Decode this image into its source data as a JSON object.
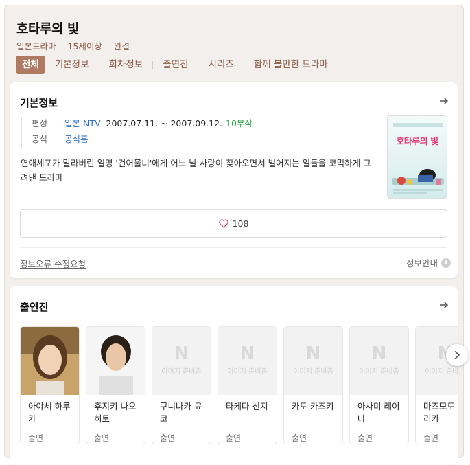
{
  "header": {
    "title": "호타루의 빛",
    "meta": [
      "일본드라마",
      "15세이상",
      "완결"
    ]
  },
  "tabs": [
    "전체",
    "기본정보",
    "회차정보",
    "출연진",
    "시리즈",
    "함께 볼만한 드라마"
  ],
  "basic_info": {
    "section_title": "기본정보",
    "broadcast_label": "편성",
    "broadcaster": "일본 NTV",
    "period": "2007.07.11. ~ 2007.09.12.",
    "episodes": "10부작",
    "official_label": "공식",
    "official_link": "공식홈",
    "description": "연애세포가 말라버린 일명 '건어물녀'에게 어느 날 사랑이 찾아오면서 벌어지는 일들을 코믹하게 그려낸 드라마",
    "poster_title": "호타루의 빛",
    "like_count": "108",
    "report_link": "정보오류 수정요청",
    "info_guide": "정보안내"
  },
  "cast": {
    "section_title": "출연진",
    "placeholder_logo": "N",
    "placeholder_text": "이미지 준비중",
    "members": [
      {
        "name": "아야세 하루카",
        "role": "출연",
        "has_photo": true
      },
      {
        "name": "후지키 나오히토",
        "role": "출연",
        "has_photo": true
      },
      {
        "name": "쿠니나카 료코",
        "role": "출연",
        "has_photo": false
      },
      {
        "name": "타케다 신지",
        "role": "출연",
        "has_photo": false
      },
      {
        "name": "카토 카즈키",
        "role": "출연",
        "has_photo": false
      },
      {
        "name": "아사미 레이나",
        "role": "출연",
        "has_photo": false
      },
      {
        "name": "마즈모토 마리카",
        "role": "출연",
        "has_photo": false
      }
    ]
  },
  "colors": {
    "accent": "#b07a62",
    "link_blue": "#2f6fc4",
    "episodes_green": "#2ea54a",
    "background": "#f3efec"
  }
}
